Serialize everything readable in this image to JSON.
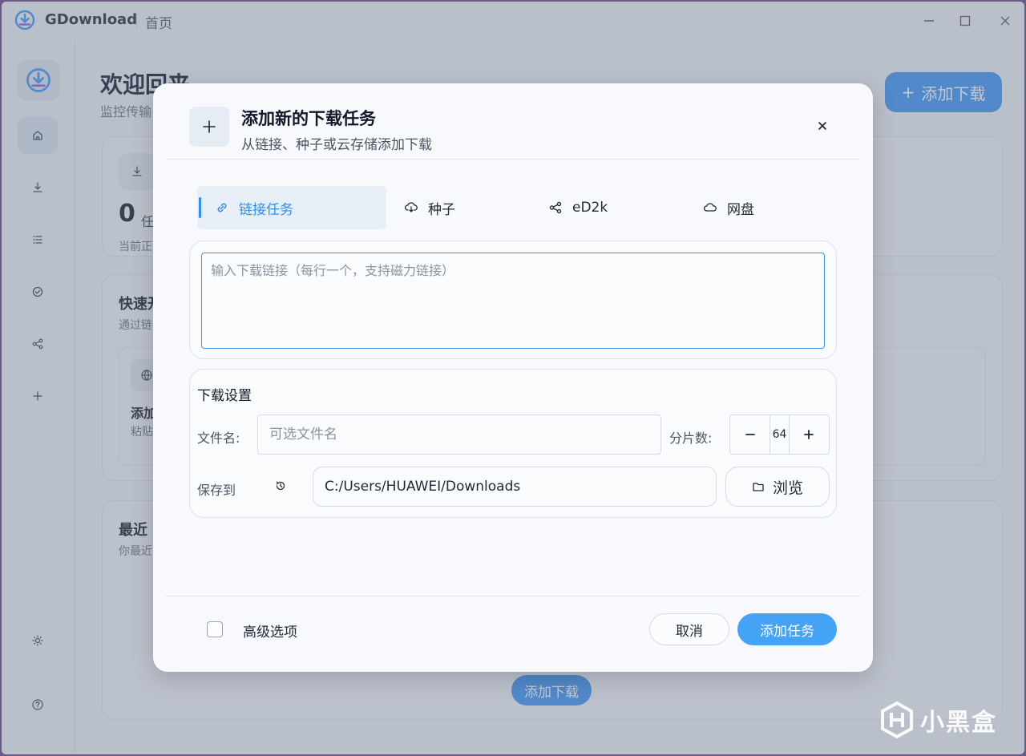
{
  "titlebar": {
    "app_name": "GDownload",
    "page": "首页",
    "minimize_icon": "minimize-icon",
    "maximize_icon": "maximize-icon",
    "close_icon": "close-icon"
  },
  "sidebar": {
    "items": [
      {
        "name": "home",
        "icon": "home-icon",
        "active": true
      },
      {
        "name": "downloads",
        "icon": "download-icon",
        "active": false
      },
      {
        "name": "list",
        "icon": "list-icon",
        "active": false
      },
      {
        "name": "completed",
        "icon": "check-circle-icon",
        "active": false
      },
      {
        "name": "share",
        "icon": "share-icon",
        "active": false
      },
      {
        "name": "add",
        "icon": "plus-icon",
        "active": false
      },
      {
        "name": "settings",
        "icon": "sun-icon",
        "active": false
      },
      {
        "name": "help",
        "icon": "help-icon",
        "active": false
      }
    ]
  },
  "main": {
    "welcome": "欢迎回来",
    "welcome_sub": "监控传输",
    "add_download_button": "添加下载",
    "stats": {
      "count": "0",
      "unit": "任",
      "caption": "当前正"
    },
    "quick_start": {
      "title": "快速开",
      "subtitle": "通过链",
      "item_title": "添加",
      "item_sub": "粘贴"
    },
    "recent": {
      "title": "最近",
      "subtitle": "你最近",
      "button": "添加下载"
    }
  },
  "modal": {
    "title": "添加新的下载任务",
    "subtitle": "从链接、种子或云存储添加下载",
    "tabs": [
      {
        "label": "链接任务",
        "icon": "link-icon",
        "active": true
      },
      {
        "label": "种子",
        "icon": "cloud-download-icon",
        "active": false
      },
      {
        "label": "eD2k",
        "icon": "share-icon",
        "active": false
      },
      {
        "label": "网盘",
        "icon": "cloud-icon",
        "active": false
      }
    ],
    "url_input": {
      "placeholder": "输入下载链接（每行一个，支持磁力链接）",
      "value": ""
    },
    "settings": {
      "title": "下载设置",
      "filename_label": "文件名:",
      "filename_placeholder": "可选文件名",
      "segments_label": "分片数:",
      "segments_value": "64",
      "save_label": "保存到",
      "save_path": "C:/Users/HUAWEI/Downloads",
      "browse_label": "浏览"
    },
    "advanced_label": "高级选项",
    "advanced_checked": false,
    "cancel_label": "取消",
    "submit_label": "添加任务"
  },
  "watermark": {
    "text": "小黑盒"
  },
  "colors": {
    "accent": "#3b93f5",
    "primary_button": "#45a3f7",
    "window_bg": "#eef1f5",
    "modal_bg": "#f7f9fc",
    "frame": "#6a5a86"
  }
}
